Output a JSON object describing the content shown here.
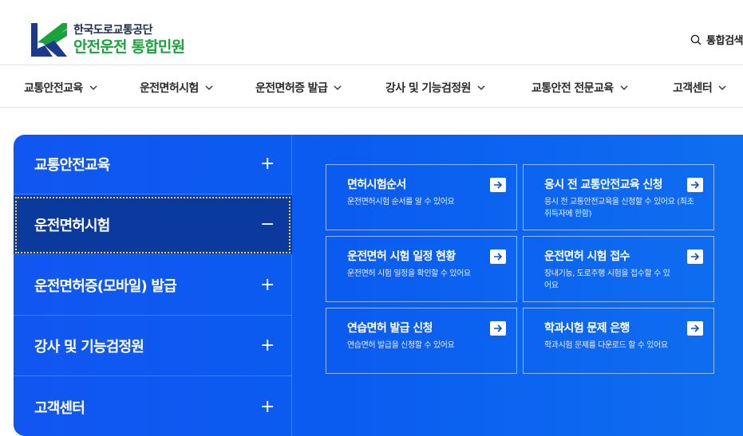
{
  "brand": {
    "org_name": "한국도로교통공단",
    "service_name": "안전운전 통합민원",
    "colors": {
      "navy": "#1b2a4a",
      "green": "#19a33c",
      "panel_blue": "#0a5cf0"
    }
  },
  "search": {
    "label": "통합검색",
    "icon": "search-icon"
  },
  "gnb": {
    "items": [
      {
        "label": "교통안전교육"
      },
      {
        "label": "운전면허시험"
      },
      {
        "label": "운전면허증 발급"
      },
      {
        "label": "강사 및 기능검정원"
      },
      {
        "label": "교통안전 전문교육"
      },
      {
        "label": "고객센터"
      }
    ]
  },
  "menu": {
    "items": [
      {
        "label": "교통안전교육",
        "state": "+"
      },
      {
        "label": "운전면허시험",
        "state": "−"
      },
      {
        "label": "운전면허증(모바일) 발급",
        "state": "+"
      },
      {
        "label": "강사 및 기능검정원",
        "state": "+"
      },
      {
        "label": "고객센터",
        "state": "+"
      }
    ],
    "active_index": 1
  },
  "cards": [
    {
      "title": "면허시험순서",
      "desc": "운전면허시험 순서를 알 수 있어요"
    },
    {
      "title": "응시 전 교통안전교육 신청",
      "desc": "응시 전 교통안전교육을 신청할 수 있어요 (최초 취득자에 한함)"
    },
    {
      "title": "운전면허 시험 일정 현황",
      "desc": "운전면허 시험 일정을 확인할 수 있어요"
    },
    {
      "title": "운전면허 시험 접수",
      "desc": "장내기능, 도로주행 시험을 접수할 수 있어요"
    },
    {
      "title": "연습면허 발급 신청",
      "desc": "연습면허 발급을 신청할 수 있어요"
    },
    {
      "title": "학과시험 문제 은행",
      "desc": "학과시험 문제를 다운로드 할 수 있어요"
    }
  ]
}
